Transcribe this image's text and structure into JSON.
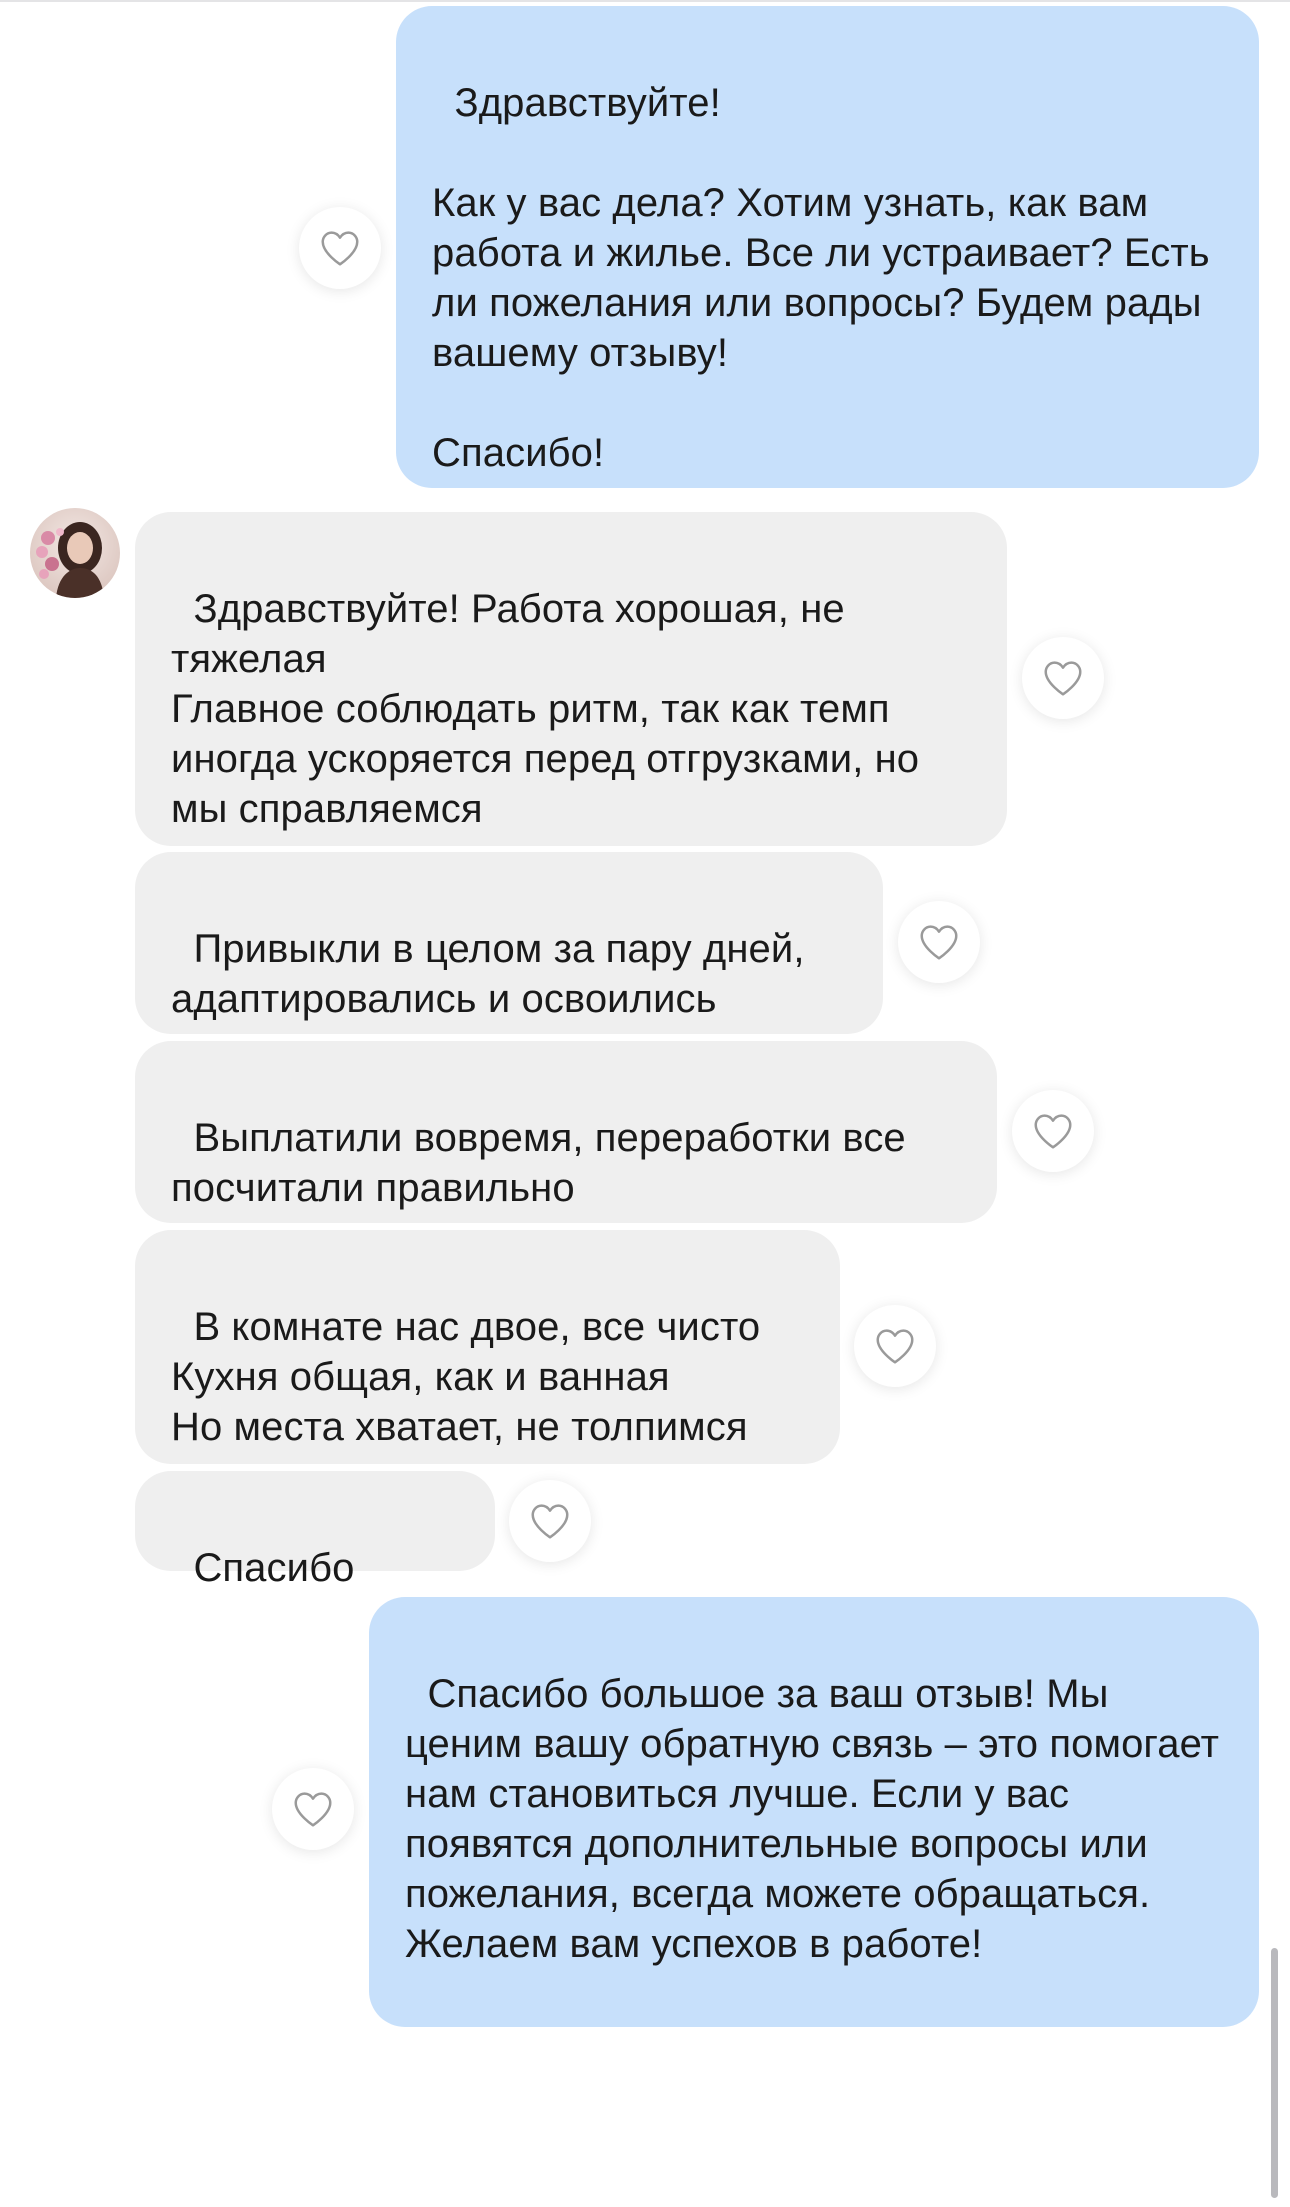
{
  "chat": {
    "messages": [
      {
        "direction": "outgoing",
        "text": "Здравствуйте!\n\nКак у вас дела? Хотим узнать, как вам работа и жилье. Все ли устраивает? Есть ли пожелания или вопросы? Будем рады вашему отзыву!\n\nСпасибо!"
      },
      {
        "direction": "incoming",
        "text": "Здравствуйте! Работа хорошая, не тяжелая\nГлавное соблюдать ритм, так как темп иногда ускоряется перед отгрузками, но мы справляемся"
      },
      {
        "direction": "incoming",
        "text": "Привыкли в целом за пару дней, адаптировались и освоились"
      },
      {
        "direction": "incoming",
        "text": "Выплатили вовремя, переработки все посчитали правильно"
      },
      {
        "direction": "incoming",
        "text": "В комнате нас двое, все чисто\nКухня общая, как и ванная\nНо места хватает, не толпимся"
      },
      {
        "direction": "incoming",
        "text": "Спасибо"
      },
      {
        "direction": "outgoing",
        "text": "Спасибо большое за ваш отзыв! Мы ценим вашу обратную связь – это помогает нам становиться лучше. Если у вас появятся дополнительные вопросы или пожелания, всегда можете обращаться. Желаем вам успехов в работе!"
      }
    ],
    "like_icon": "heart-outline-icon",
    "avatar_icon": "contact-avatar"
  },
  "colors": {
    "outgoing_bubble": "#c7e0fb",
    "incoming_bubble": "#efefef",
    "heart_stroke": "#9a9a9a",
    "background": "#ffffff"
  }
}
